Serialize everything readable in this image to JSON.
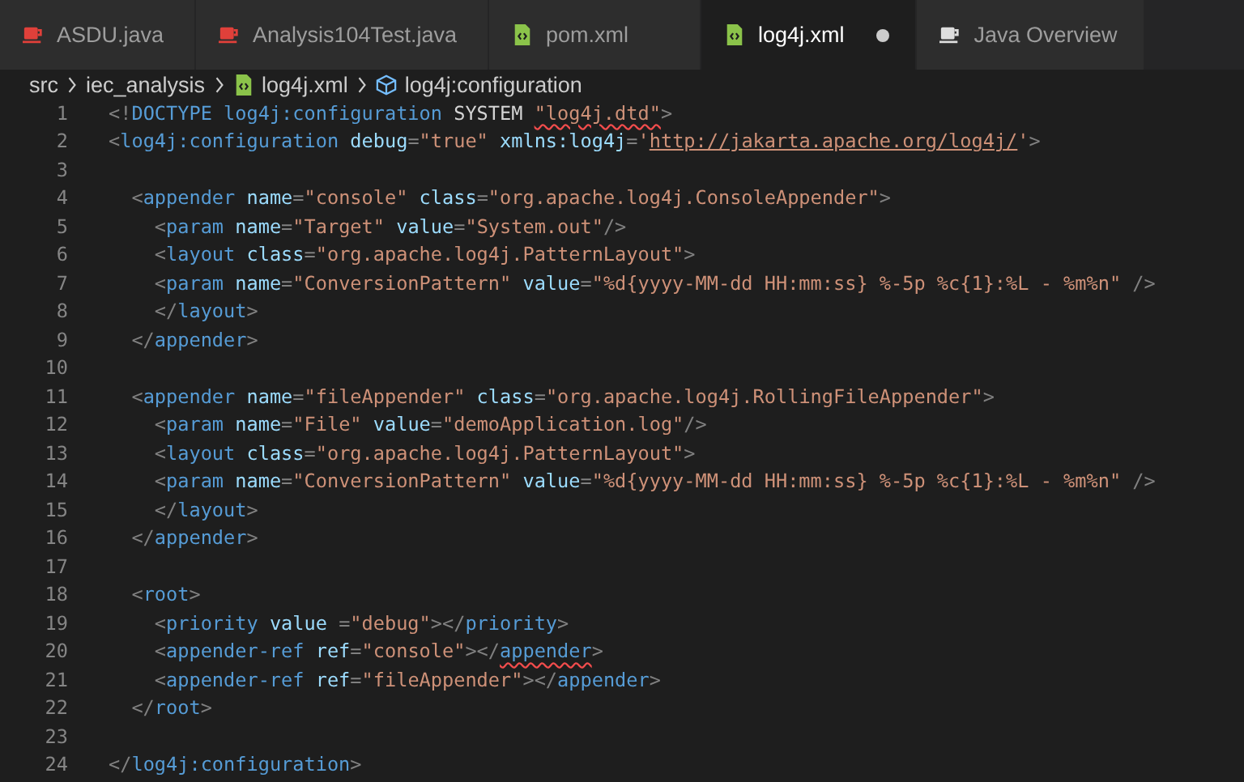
{
  "tabs": [
    {
      "label": "ASDU.java",
      "kind": "java",
      "selected": false,
      "modified": false
    },
    {
      "label": "Analysis104Test.java",
      "kind": "java",
      "selected": false,
      "modified": false
    },
    {
      "label": "pom.xml",
      "kind": "xml",
      "selected": false,
      "modified": false
    },
    {
      "label": "log4j.xml",
      "kind": "xml",
      "selected": true,
      "modified": true
    },
    {
      "label": "Java Overview",
      "kind": "overview",
      "selected": false,
      "modified": false
    }
  ],
  "breadcrumb": [
    {
      "label": "src",
      "kind": "folder"
    },
    {
      "label": "iec_analysis",
      "kind": "folder"
    },
    {
      "label": "log4j.xml",
      "kind": "xml"
    },
    {
      "label": "log4j:configuration",
      "kind": "element"
    }
  ],
  "editor": {
    "lines": [
      {
        "number": "1",
        "tokens": [
          {
            "kind": "punct",
            "text": "<!"
          },
          {
            "kind": "tag",
            "text": "DOCTYPE log4j:configuration"
          },
          {
            "kind": "text",
            "text": " SYSTEM "
          },
          {
            "kind": "string",
            "text": "\"log4j.dtd\"",
            "error": true
          },
          {
            "kind": "punct",
            "text": ">"
          }
        ]
      },
      {
        "number": "2",
        "tokens": [
          {
            "kind": "punct",
            "text": "<"
          },
          {
            "kind": "tag",
            "text": "log4j:configuration"
          },
          {
            "kind": "attr",
            "text": " debug"
          },
          {
            "kind": "punct",
            "text": "="
          },
          {
            "kind": "string",
            "text": "\"true\""
          },
          {
            "kind": "attr",
            "text": " xmlns:log4j"
          },
          {
            "kind": "punct",
            "text": "="
          },
          {
            "kind": "string",
            "text": "'"
          },
          {
            "kind": "link",
            "text": "http://jakarta.apache.org/log4j/"
          },
          {
            "kind": "string",
            "text": "'"
          },
          {
            "kind": "punct",
            "text": ">"
          }
        ]
      },
      {
        "number": "3"
      },
      {
        "number": "4",
        "tokens": [
          {
            "kind": "punct",
            "text": "  <"
          },
          {
            "kind": "tag",
            "text": "appender"
          },
          {
            "kind": "attr",
            "text": " name"
          },
          {
            "kind": "punct",
            "text": "="
          },
          {
            "kind": "string",
            "text": "\"console\""
          },
          {
            "kind": "attr",
            "text": " class"
          },
          {
            "kind": "punct",
            "text": "="
          },
          {
            "kind": "string",
            "text": "\"org.apache.log4j.ConsoleAppender\""
          },
          {
            "kind": "punct",
            "text": ">"
          }
        ]
      },
      {
        "number": "5",
        "tokens": [
          {
            "kind": "punct",
            "text": "    <"
          },
          {
            "kind": "tag",
            "text": "param"
          },
          {
            "kind": "attr",
            "text": " name"
          },
          {
            "kind": "punct",
            "text": "="
          },
          {
            "kind": "string",
            "text": "\"Target\""
          },
          {
            "kind": "attr",
            "text": " value"
          },
          {
            "kind": "punct",
            "text": "="
          },
          {
            "kind": "string",
            "text": "\"System.out\""
          },
          {
            "kind": "punct",
            "text": "/>"
          }
        ]
      },
      {
        "number": "6",
        "tokens": [
          {
            "kind": "punct",
            "text": "    <"
          },
          {
            "kind": "tag",
            "text": "layout"
          },
          {
            "kind": "attr",
            "text": " class"
          },
          {
            "kind": "punct",
            "text": "="
          },
          {
            "kind": "string",
            "text": "\"org.apache.log4j.PatternLayout\""
          },
          {
            "kind": "punct",
            "text": ">"
          }
        ]
      },
      {
        "number": "7",
        "tokens": [
          {
            "kind": "punct",
            "text": "    <"
          },
          {
            "kind": "tag",
            "text": "param"
          },
          {
            "kind": "attr",
            "text": " name"
          },
          {
            "kind": "punct",
            "text": "="
          },
          {
            "kind": "string",
            "text": "\"ConversionPattern\""
          },
          {
            "kind": "attr",
            "text": " value"
          },
          {
            "kind": "punct",
            "text": "="
          },
          {
            "kind": "string",
            "text": "\"%d{yyyy-MM-dd HH:mm:ss} %-5p %c{1}:%L - %m%n\""
          },
          {
            "kind": "punct",
            "text": " />"
          }
        ]
      },
      {
        "number": "8",
        "tokens": [
          {
            "kind": "punct",
            "text": "    </"
          },
          {
            "kind": "tag",
            "text": "layout"
          },
          {
            "kind": "punct",
            "text": ">"
          }
        ]
      },
      {
        "number": "9",
        "tokens": [
          {
            "kind": "punct",
            "text": "  </"
          },
          {
            "kind": "tag",
            "text": "appender"
          },
          {
            "kind": "punct",
            "text": ">"
          }
        ]
      },
      {
        "number": "10"
      },
      {
        "number": "11",
        "tokens": [
          {
            "kind": "punct",
            "text": "  <"
          },
          {
            "kind": "tag",
            "text": "appender"
          },
          {
            "kind": "attr",
            "text": " name"
          },
          {
            "kind": "punct",
            "text": "="
          },
          {
            "kind": "string",
            "text": "\"fileAppender\""
          },
          {
            "kind": "attr",
            "text": " class"
          },
          {
            "kind": "punct",
            "text": "="
          },
          {
            "kind": "string",
            "text": "\"org.apache.log4j.RollingFileAppender\""
          },
          {
            "kind": "punct",
            "text": ">"
          }
        ]
      },
      {
        "number": "12",
        "tokens": [
          {
            "kind": "punct",
            "text": "    <"
          },
          {
            "kind": "tag",
            "text": "param"
          },
          {
            "kind": "attr",
            "text": " name"
          },
          {
            "kind": "punct",
            "text": "="
          },
          {
            "kind": "string",
            "text": "\"File\""
          },
          {
            "kind": "attr",
            "text": " value"
          },
          {
            "kind": "punct",
            "text": "="
          },
          {
            "kind": "string",
            "text": "\"demoApplication.log\""
          },
          {
            "kind": "punct",
            "text": "/>"
          }
        ]
      },
      {
        "number": "13",
        "tokens": [
          {
            "kind": "punct",
            "text": "    <"
          },
          {
            "kind": "tag",
            "text": "layout"
          },
          {
            "kind": "attr",
            "text": " class"
          },
          {
            "kind": "punct",
            "text": "="
          },
          {
            "kind": "string",
            "text": "\"org.apache.log4j.PatternLayout\""
          },
          {
            "kind": "punct",
            "text": ">"
          }
        ]
      },
      {
        "number": "14",
        "tokens": [
          {
            "kind": "punct",
            "text": "    <"
          },
          {
            "kind": "tag",
            "text": "param"
          },
          {
            "kind": "attr",
            "text": " name"
          },
          {
            "kind": "punct",
            "text": "="
          },
          {
            "kind": "string",
            "text": "\"ConversionPattern\""
          },
          {
            "kind": "attr",
            "text": " value"
          },
          {
            "kind": "punct",
            "text": "="
          },
          {
            "kind": "string",
            "text": "\"%d{yyyy-MM-dd HH:mm:ss} %-5p %c{1}:%L - %m%n\""
          },
          {
            "kind": "punct",
            "text": " />"
          }
        ]
      },
      {
        "number": "15",
        "tokens": [
          {
            "kind": "punct",
            "text": "    </"
          },
          {
            "kind": "tag",
            "text": "layout"
          },
          {
            "kind": "punct",
            "text": ">"
          }
        ]
      },
      {
        "number": "16",
        "tokens": [
          {
            "kind": "punct",
            "text": "  </"
          },
          {
            "kind": "tag",
            "text": "appender"
          },
          {
            "kind": "punct",
            "text": ">"
          }
        ]
      },
      {
        "number": "17"
      },
      {
        "number": "18",
        "tokens": [
          {
            "kind": "punct",
            "text": "  <"
          },
          {
            "kind": "tag",
            "text": "root"
          },
          {
            "kind": "punct",
            "text": ">"
          }
        ]
      },
      {
        "number": "19",
        "tokens": [
          {
            "kind": "punct",
            "text": "    <"
          },
          {
            "kind": "tag",
            "text": "priority"
          },
          {
            "kind": "attr",
            "text": " value "
          },
          {
            "kind": "punct",
            "text": "="
          },
          {
            "kind": "string",
            "text": "\"debug\""
          },
          {
            "kind": "punct",
            "text": "></"
          },
          {
            "kind": "tag",
            "text": "priority"
          },
          {
            "kind": "punct",
            "text": ">"
          }
        ]
      },
      {
        "number": "20",
        "tokens": [
          {
            "kind": "punct",
            "text": "    <"
          },
          {
            "kind": "tag",
            "text": "appender-ref"
          },
          {
            "kind": "attr",
            "text": " ref"
          },
          {
            "kind": "punct",
            "text": "="
          },
          {
            "kind": "string",
            "text": "\"console\""
          },
          {
            "kind": "punct",
            "text": "></"
          },
          {
            "kind": "tag",
            "text": "appender",
            "error": true
          },
          {
            "kind": "punct",
            "text": ">"
          }
        ]
      },
      {
        "number": "21",
        "tokens": [
          {
            "kind": "punct",
            "text": "    <"
          },
          {
            "kind": "tag",
            "text": "appender-ref"
          },
          {
            "kind": "attr",
            "text": " ref"
          },
          {
            "kind": "punct",
            "text": "="
          },
          {
            "kind": "string",
            "text": "\"fileAppender\""
          },
          {
            "kind": "punct",
            "text": "></"
          },
          {
            "kind": "tag",
            "text": "appender"
          },
          {
            "kind": "punct",
            "text": ">"
          }
        ]
      },
      {
        "number": "22",
        "tokens": [
          {
            "kind": "punct",
            "text": "  </"
          },
          {
            "kind": "tag",
            "text": "root"
          },
          {
            "kind": "punct",
            "text": ">"
          }
        ]
      },
      {
        "number": "23"
      },
      {
        "number": "24",
        "tokens": [
          {
            "kind": "punct",
            "text": "</"
          },
          {
            "kind": "tag",
            "text": "log4j:configuration"
          },
          {
            "kind": "punct",
            "text": ">"
          }
        ]
      }
    ]
  }
}
